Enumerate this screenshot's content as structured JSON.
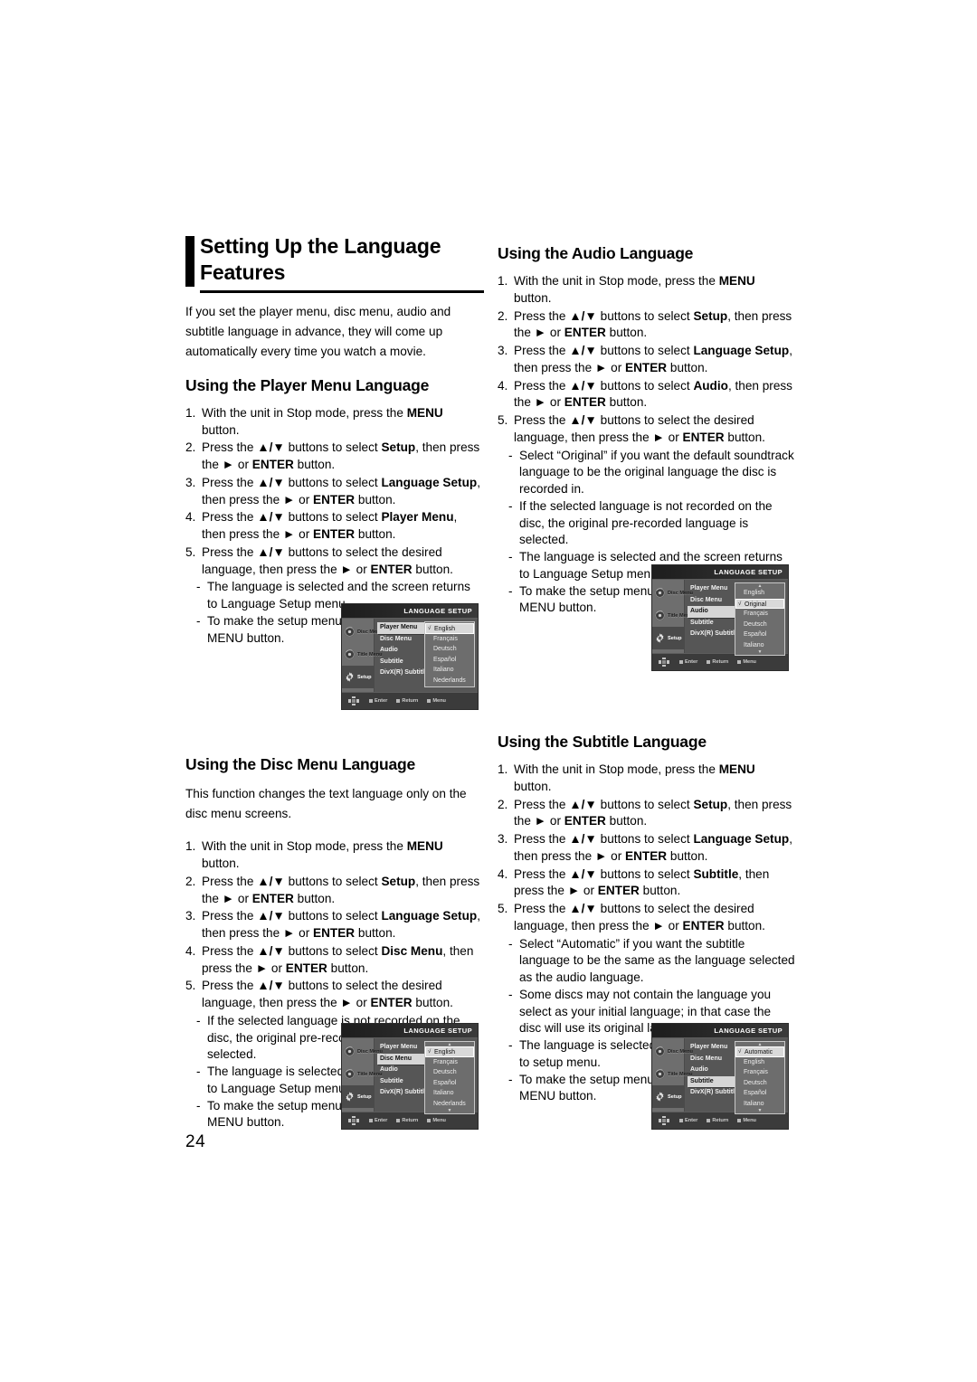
{
  "page": {
    "number": "24"
  },
  "main_title": {
    "line1": "Setting Up the Language",
    "line2": "Features"
  },
  "intro": "If you set the player menu, disc menu, audio and subtitle language in advance, they will come up automatically every time you watch a movie.",
  "sections": {
    "player_menu": {
      "heading": "Using the Player Menu Language",
      "steps": [
        {
          "num": "1.",
          "parts": [
            {
              "t": "With the unit in Stop mode, press the "
            },
            {
              "t": "MENU",
              "b": true
            },
            {
              "t": " button."
            }
          ]
        },
        {
          "num": "2.",
          "parts": [
            {
              "t": "Press the "
            },
            {
              "t": "▲/▼",
              "b": true
            },
            {
              "t": " buttons to select "
            },
            {
              "t": "Setup",
              "b": true
            },
            {
              "t": ", then press the ►  or "
            },
            {
              "t": "ENTER",
              "b": true
            },
            {
              "t": " button."
            }
          ]
        },
        {
          "num": "3.",
          "parts": [
            {
              "t": "Press the "
            },
            {
              "t": "▲/▼",
              "b": true
            },
            {
              "t": " buttons to select "
            },
            {
              "t": "Language Setup",
              "b": true
            },
            {
              "t": ", then press the ► or "
            },
            {
              "t": "ENTER",
              "b": true
            },
            {
              "t": " button."
            }
          ]
        },
        {
          "num": "4.",
          "parts": [
            {
              "t": "Press the "
            },
            {
              "t": "▲/▼",
              "b": true
            },
            {
              "t": " buttons to select "
            },
            {
              "t": "Player Menu",
              "b": true
            },
            {
              "t": ", then press the ► or "
            },
            {
              "t": "ENTER",
              "b": true
            },
            {
              "t": " button."
            }
          ]
        },
        {
          "num": "5.",
          "parts": [
            {
              "t": "Press the "
            },
            {
              "t": "▲/▼",
              "b": true
            },
            {
              "t": " buttons to select the desired language, then press the ► or "
            },
            {
              "t": "ENTER",
              "b": true
            },
            {
              "t": " button."
            }
          ]
        }
      ],
      "notes": [
        "The language is selected and the screen  returns to Language Setup menu.",
        "To make the setup menu disappear, press the MENU button."
      ]
    },
    "disc_menu": {
      "heading": "Using the Disc Menu Language",
      "intro": "This function changes the text language only on the disc menu screens.",
      "steps": [
        {
          "num": "1.",
          "parts": [
            {
              "t": "With the unit in Stop mode, press the "
            },
            {
              "t": "MENU",
              "b": true
            },
            {
              "t": " button."
            }
          ]
        },
        {
          "num": "2.",
          "parts": [
            {
              "t": "Press the "
            },
            {
              "t": "▲/▼",
              "b": true
            },
            {
              "t": " buttons to select "
            },
            {
              "t": "Setup",
              "b": true
            },
            {
              "t": ", then press the ►  or "
            },
            {
              "t": "ENTER",
              "b": true
            },
            {
              "t": " button."
            }
          ]
        },
        {
          "num": "3.",
          "parts": [
            {
              "t": "Press the "
            },
            {
              "t": "▲/▼",
              "b": true
            },
            {
              "t": " buttons to select "
            },
            {
              "t": "Language Setup",
              "b": true
            },
            {
              "t": ", then press the ► or "
            },
            {
              "t": "ENTER",
              "b": true
            },
            {
              "t": " button."
            }
          ]
        },
        {
          "num": "4.",
          "parts": [
            {
              "t": "Press the  "
            },
            {
              "t": "▲/▼",
              "b": true
            },
            {
              "t": " buttons to select "
            },
            {
              "t": "Disc Menu",
              "b": true
            },
            {
              "t": ", then press the ► or "
            },
            {
              "t": "ENTER",
              "b": true
            },
            {
              "t": "  button."
            }
          ]
        },
        {
          "num": "5.",
          "parts": [
            {
              "t": "Press the "
            },
            {
              "t": "▲/▼",
              "b": true
            },
            {
              "t": " buttons to select the desired language, then press the ► or "
            },
            {
              "t": "ENTER",
              "b": true
            },
            {
              "t": " button."
            }
          ]
        }
      ],
      "notes": [
        "If the selected language is not recorded on  the disc, the original pre-recorded language is selected.",
        "The language is selected and the screen returns to Language Setup menu.",
        "To make the setup menu disappear, press the MENU button."
      ]
    },
    "audio": {
      "heading": "Using the Audio Language",
      "steps": [
        {
          "num": "1.",
          "parts": [
            {
              "t": "With the unit in Stop mode, press the "
            },
            {
              "t": "MENU",
              "b": true
            },
            {
              "t": " button."
            }
          ]
        },
        {
          "num": "2.",
          "parts": [
            {
              "t": "Press the "
            },
            {
              "t": "▲/▼",
              "b": true
            },
            {
              "t": " buttons to select "
            },
            {
              "t": "Setup",
              "b": true
            },
            {
              "t": ", then press the ► or "
            },
            {
              "t": "ENTER",
              "b": true
            },
            {
              "t": " button."
            }
          ]
        },
        {
          "num": "3.",
          "parts": [
            {
              "t": "Press the "
            },
            {
              "t": "▲/▼",
              "b": true
            },
            {
              "t": " buttons to select "
            },
            {
              "t": "Language Setup",
              "b": true
            },
            {
              "t": ", then press the ► or "
            },
            {
              "t": "ENTER",
              "b": true
            },
            {
              "t": " button."
            }
          ]
        },
        {
          "num": "4.",
          "parts": [
            {
              "t": "Press the "
            },
            {
              "t": "▲/▼",
              "b": true
            },
            {
              "t": " buttons to select "
            },
            {
              "t": "Audio",
              "b": true
            },
            {
              "t": ", then press the ► or "
            },
            {
              "t": "ENTER",
              "b": true
            },
            {
              "t": " button."
            }
          ]
        },
        {
          "num": "5.",
          "parts": [
            {
              "t": "Press the "
            },
            {
              "t": "▲/▼",
              "b": true
            },
            {
              "t": " buttons to select the desired language, then press the ► or "
            },
            {
              "t": "ENTER",
              "b": true
            },
            {
              "t": " button."
            }
          ]
        }
      ],
      "notes": [
        "Select “Original” if you want the default soundtrack language to be the original language the disc is recorded in.",
        "If the selected language is not recorded on the disc, the original pre-recorded language is selected.",
        "The language is selected and the screen returns to Language Setup menu.",
        "To make the setup menu disappear, press the MENU button."
      ]
    },
    "subtitle": {
      "heading": "Using the Subtitle Language",
      "steps": [
        {
          "num": "1.",
          "parts": [
            {
              "t": "With the unit in Stop mode, press the "
            },
            {
              "t": "MENU",
              "b": true
            },
            {
              "t": " button."
            }
          ]
        },
        {
          "num": "2.",
          "parts": [
            {
              "t": "Press the "
            },
            {
              "t": "▲/▼",
              "b": true
            },
            {
              "t": " buttons to select "
            },
            {
              "t": "Setup",
              "b": true
            },
            {
              "t": ", then press the ► or "
            },
            {
              "t": "ENTER",
              "b": true
            },
            {
              "t": " button."
            }
          ]
        },
        {
          "num": "3.",
          "parts": [
            {
              "t": "Press the "
            },
            {
              "t": "▲/▼",
              "b": true
            },
            {
              "t": " buttons to select "
            },
            {
              "t": "Language Setup",
              "b": true
            },
            {
              "t": ", then press the ► or "
            },
            {
              "t": "ENTER",
              "b": true
            },
            {
              "t": " button."
            }
          ]
        },
        {
          "num": "4.",
          "parts": [
            {
              "t": "Press the "
            },
            {
              "t": "▲/▼",
              "b": true
            },
            {
              "t": " buttons to select "
            },
            {
              "t": "Subtitle",
              "b": true
            },
            {
              "t": ", then press the ► or "
            },
            {
              "t": "ENTER",
              "b": true
            },
            {
              "t": " button."
            }
          ]
        },
        {
          "num": "5.",
          "parts": [
            {
              "t": "Press the "
            },
            {
              "t": "▲/▼",
              "b": true
            },
            {
              "t": " buttons to select the desired  language, then press the ► or "
            },
            {
              "t": "ENTER",
              "b": true
            },
            {
              "t": " button."
            }
          ]
        }
      ],
      "notes": [
        "Select “Automatic” if you want the subtitle  language to be the same as the language selected as the audio language.",
        " Some discs may not contain the language you select as your initial language; in that case the disc will use its original language setting.",
        "The language is selected and the screen returns to setup menu.",
        "To make the setup menu disappear, press the MENU button."
      ]
    }
  },
  "osd": {
    "title": "LANGUAGE SETUP",
    "sidebar": [
      {
        "label": "Disc Menu",
        "icon": "disc-icon"
      },
      {
        "label": "Title Menu",
        "icon": "disc-icon"
      },
      {
        "label": "Setup",
        "icon": "gear-icon"
      }
    ],
    "menu_items": [
      "Player Menu",
      "Disc Menu",
      "Audio",
      "Subtitle",
      "DivX(R) Subtitle"
    ],
    "footer": [
      {
        "label": "Enter"
      },
      {
        "label": "Return"
      },
      {
        "label": "Menu"
      }
    ],
    "screens": {
      "player_menu": {
        "active": "Player Menu",
        "languages": [
          "English",
          "Français",
          "Deutsch",
          "Español",
          "Italiano",
          "Nederlands"
        ],
        "selected": "English",
        "scroll_up": false,
        "scroll_down": false
      },
      "disc_menu": {
        "active": "Disc Menu",
        "languages": [
          "English",
          "Français",
          "Deutsch",
          "Español",
          "Italiano",
          "Nederlands"
        ],
        "selected": "English",
        "scroll_up": true,
        "scroll_down": true
      },
      "audio": {
        "active": "Audio",
        "languages": [
          "English",
          "Original",
          "Français",
          "Deutsch",
          "Español",
          "Italiano"
        ],
        "selected": "Original",
        "scroll_up": true,
        "scroll_down": true
      },
      "subtitle": {
        "active": "Subtitle",
        "languages": [
          "Automatic",
          "English",
          "Français",
          "Deutsch",
          "Español",
          "Italiano"
        ],
        "selected": "Automatic",
        "scroll_up": true,
        "scroll_down": true
      }
    }
  }
}
